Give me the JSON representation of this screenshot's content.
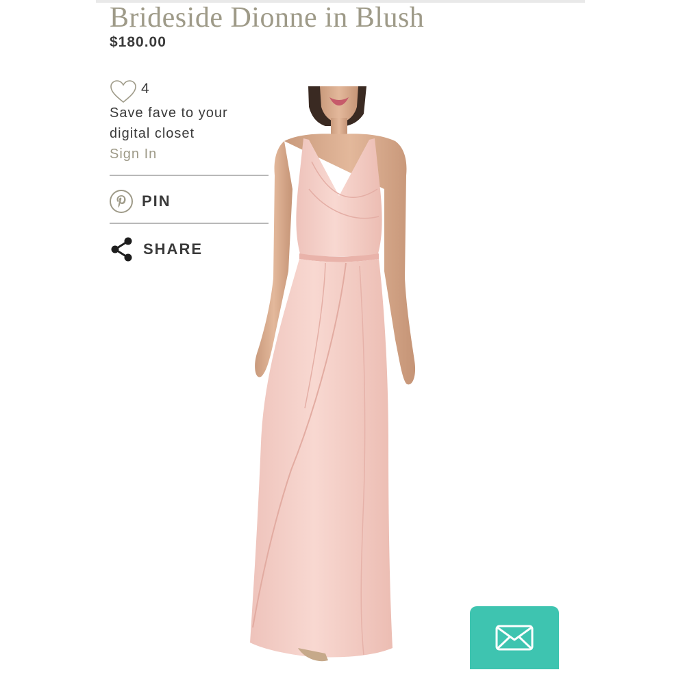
{
  "product": {
    "title": "Brideside Dionne in Blush",
    "price": "$180.00"
  },
  "favorites": {
    "count": "4",
    "prompt": "Save fave to your digital closet",
    "sign_in_label": "Sign In"
  },
  "actions": {
    "pin_label": "PIN",
    "share_label": "SHARE"
  },
  "icons": {
    "favorite": "heart-outline-icon",
    "pin": "pinterest-icon",
    "share": "share-icon",
    "contact": "envelope-icon"
  },
  "colors": {
    "accent_taupe": "#9e9a88",
    "text_dark": "#3a3a3a",
    "dress_blush": "#f5cfc8",
    "contact_teal": "#3ec4b0"
  }
}
